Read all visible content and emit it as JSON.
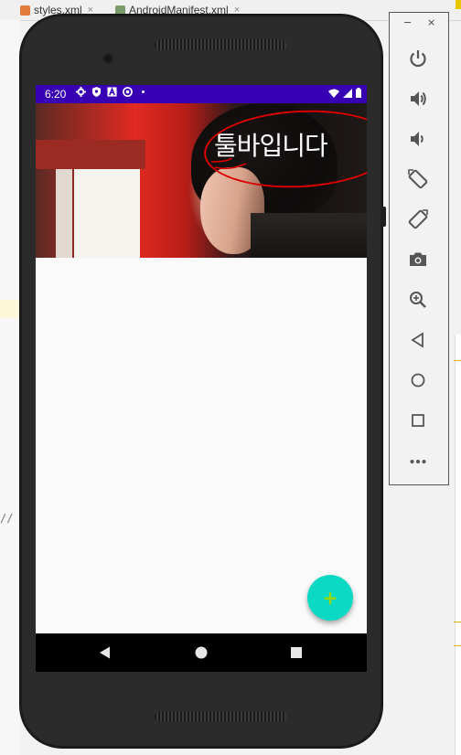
{
  "ide": {
    "tabs": [
      {
        "label": "styles.xml",
        "close": "×"
      },
      {
        "label": "AndroidManifest.xml",
        "close": "×"
      }
    ],
    "gutter_text": "//"
  },
  "status_bar": {
    "time": "6:20",
    "icons": [
      "settings-icon",
      "shield-icon",
      "a-icon",
      "at-icon",
      "dot-icon"
    ],
    "right_icons": [
      "wifi-icon",
      "signal-icon",
      "battery-icon"
    ],
    "color": "#3700b3"
  },
  "toolbar": {
    "title": "툴바입니다"
  },
  "fab": {
    "icon": "plus-icon",
    "glyph": "+",
    "color": "#0ad9c4"
  },
  "nav_bar": {
    "buttons": [
      "back-icon",
      "home-icon",
      "recents-icon"
    ]
  },
  "emulator_panel": {
    "minimize": "−",
    "close": "×",
    "buttons": [
      "power-icon",
      "volume-up-icon",
      "volume-down-icon",
      "rotate-left-icon",
      "rotate-right-icon",
      "camera-icon",
      "zoom-icon",
      "back-icon",
      "home-icon",
      "overview-icon",
      "more-icon"
    ]
  },
  "annotation": {
    "color": "#d80000"
  }
}
